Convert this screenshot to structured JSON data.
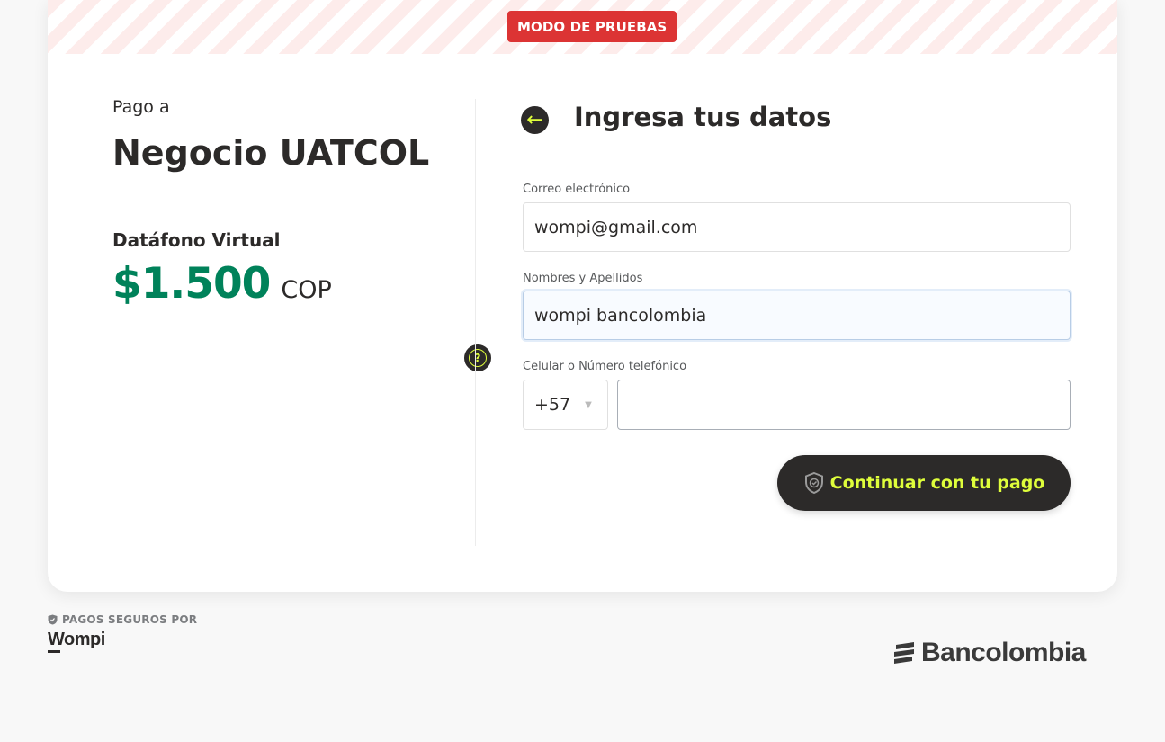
{
  "banner": {
    "badge": "MODO DE PRUEBAS"
  },
  "merchant": {
    "pay_to": "Pago a",
    "name": "Negocio UATCOL",
    "product": "Datáfono Virtual",
    "amount": "$1.500",
    "currency": "COP"
  },
  "help": {
    "icon": "question-icon",
    "glyph": "?"
  },
  "form": {
    "back_icon": "arrow-left-icon",
    "title": "Ingresa tus datos",
    "email_label": "Correo electrónico",
    "email_value": "wompi@gmail.com",
    "name_label": "Nombres y Apellidos",
    "name_value": "wompi bancolombia",
    "phone_label": "Celular o Número telefónico",
    "country_code": "+57",
    "phone_value": "",
    "continue_label": "Continuar con tu pago"
  },
  "footer": {
    "secure_text": "PAGOS SEGUROS POR",
    "wompi_logo": "Wompi",
    "bancolombia_logo": "Bancolombia"
  },
  "colors": {
    "accent_yellow": "#dffe3b",
    "amount_green": "#00825a",
    "badge_red": "#dc3434",
    "dark": "#2c2a29"
  }
}
